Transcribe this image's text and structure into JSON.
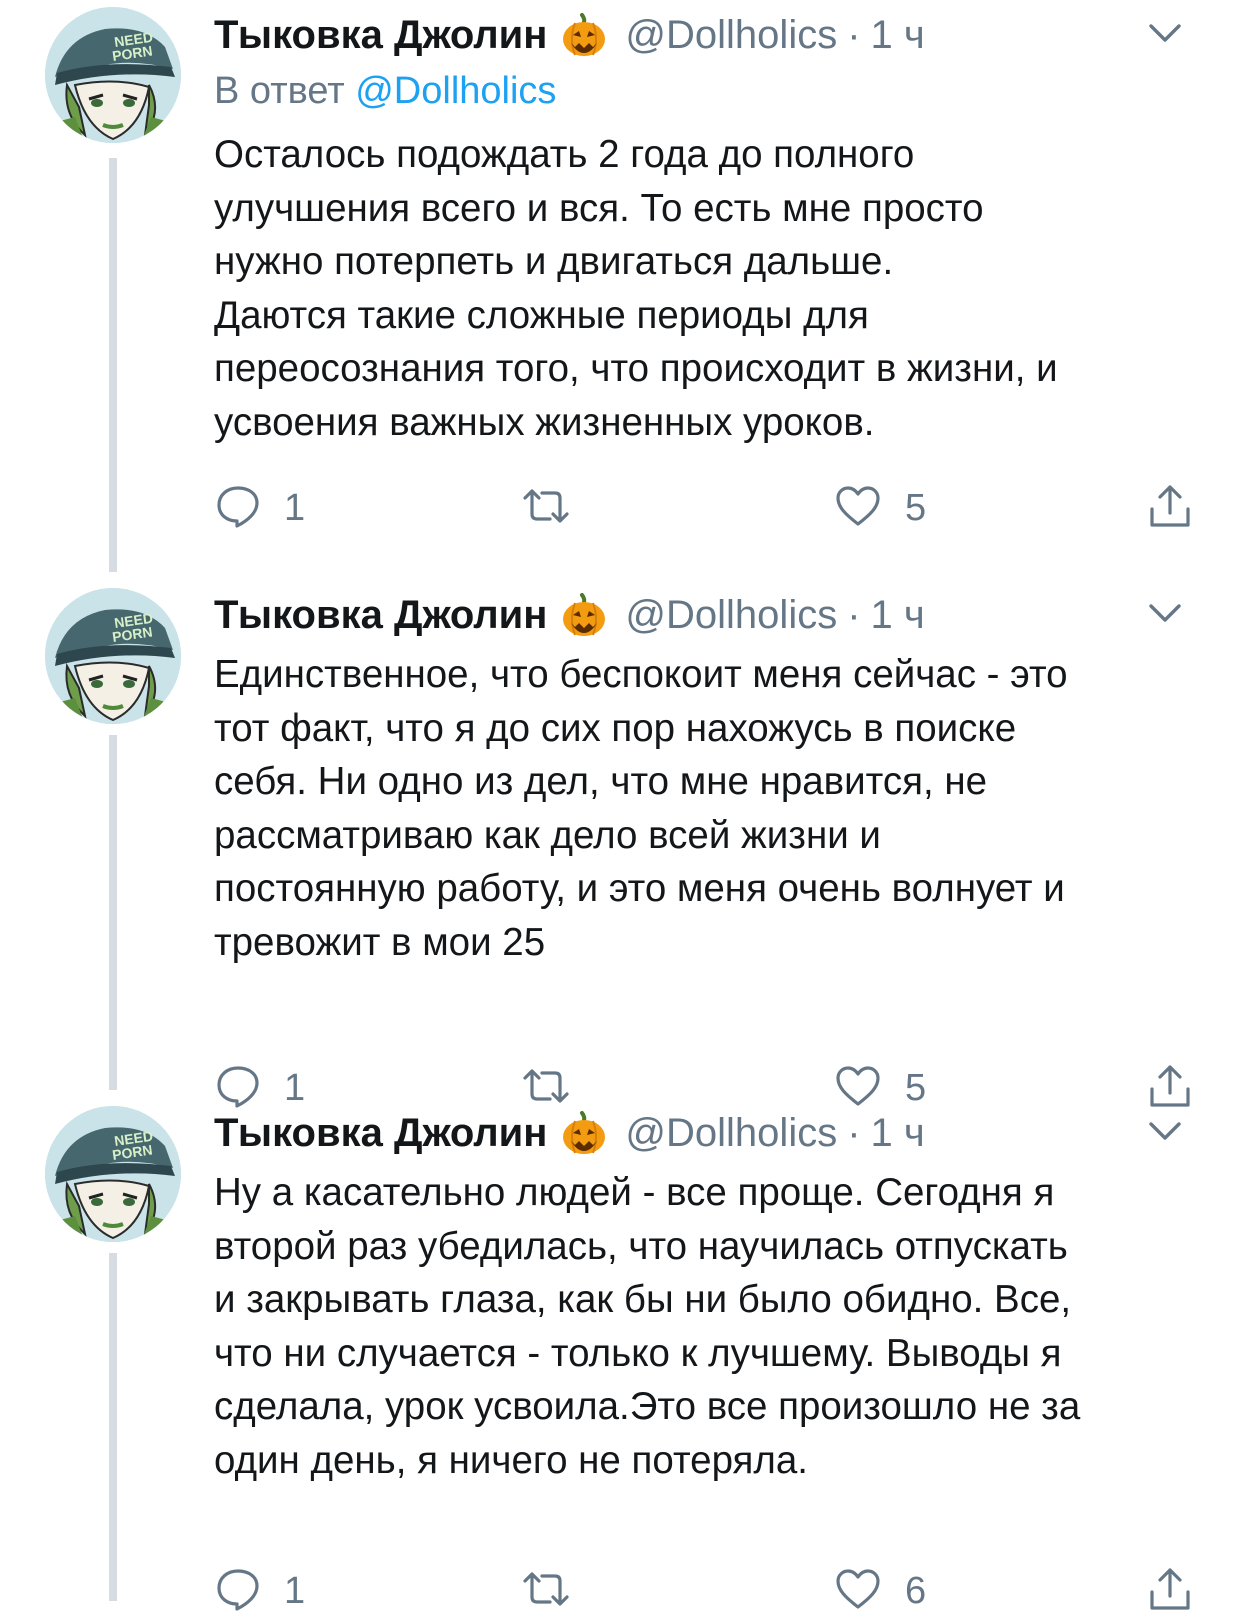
{
  "tweets": [
    {
      "author_name": "Тыковка Джолин",
      "author_emoji": "pumpkin-emoji",
      "handle": "@Dollholics",
      "separator": "·",
      "time": "1 ч",
      "reply_prefix": "В ответ",
      "reply_handle": "@Dollholics",
      "text_lines": [
        "Осталось подождать 2 года до полного",
        "улучшения всего и вся. То есть мне просто",
        "нужно потерпеть и двигаться дальше.",
        "Даются такие сложные периоды для",
        "переосознания того, что происходит в жизни, и",
        "усвоения важных жизненных уроков."
      ],
      "reply_count": "1",
      "retweet_count": "",
      "like_count": "5"
    },
    {
      "author_name": "Тыковка Джолин",
      "author_emoji": "pumpkin-emoji",
      "handle": "@Dollholics",
      "separator": "·",
      "time": "1 ч",
      "text_lines": [
        "Единственное, что беспокоит меня сейчас - это",
        "тот факт, что я до сих пор нахожусь в поиске",
        "себя. Ни одно из дел, что мне нравится, не",
        "рассматриваю как дело всей жизни и",
        "постоянную работу, и это меня очень волнует и",
        "тревожит в мои 25"
      ],
      "reply_count": "1",
      "retweet_count": "",
      "like_count": "5"
    },
    {
      "author_name": "Тыковка Джолин",
      "author_emoji": "pumpkin-emoji",
      "handle": "@Dollholics",
      "separator": "·",
      "time": "1 ч",
      "text_lines": [
        "Ну а касательно людей - все проще. Сегодня я",
        "второй раз убедилась, что научилась отпускать",
        "и закрывать глаза, как бы ни было обидно. Все,",
        "что ни случается - только к лучшему. Выводы я",
        "сделала, урок усвоила.Это все произошло не за",
        "один день, я ничего не потеряла."
      ],
      "reply_count": "1",
      "retweet_count": "",
      "like_count": "6"
    }
  ],
  "icons": {
    "reply": "reply-icon",
    "retweet": "retweet-icon",
    "like": "heart-icon",
    "share": "share-icon",
    "menu": "chevron-down-icon"
  },
  "colors": {
    "text": "#14171a",
    "secondary": "#657786",
    "link": "#1da1f2",
    "thread_line": "#d6dce1",
    "pumpkin": "#f39c12"
  }
}
